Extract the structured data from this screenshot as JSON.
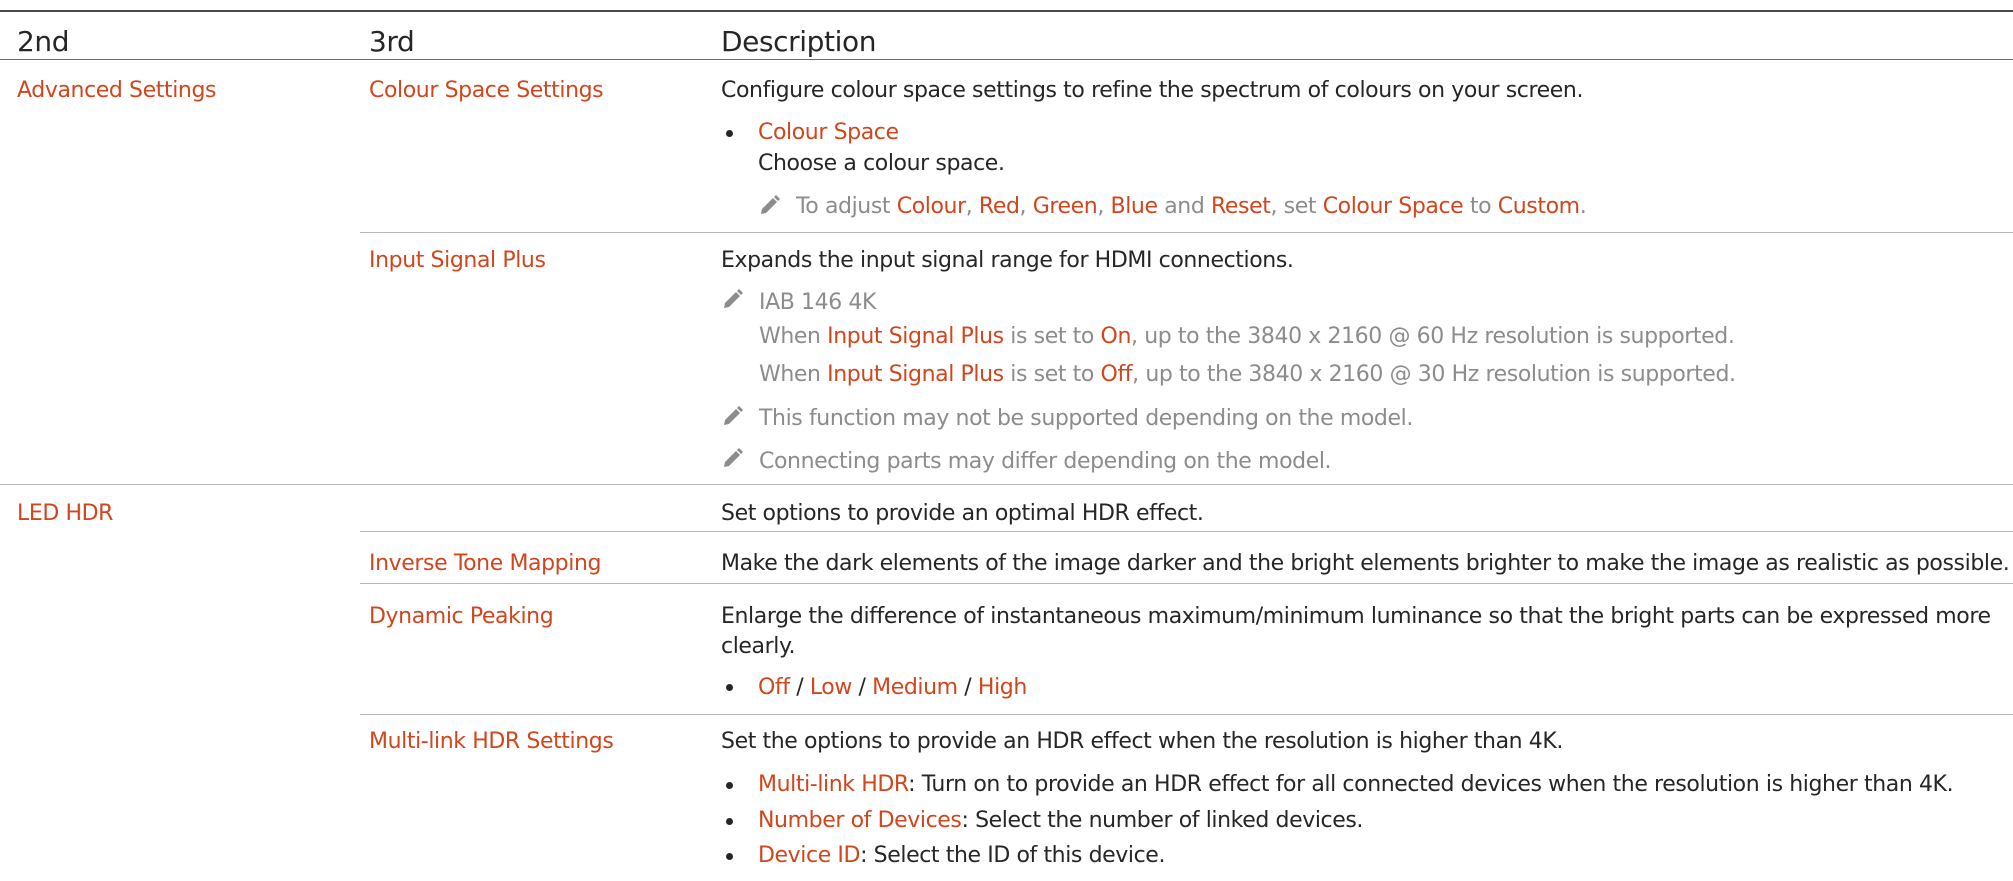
{
  "table": {
    "headers": {
      "col2": "2nd",
      "col3": "3rd",
      "desc": "Description"
    },
    "advanced": {
      "name": "Advanced Settings",
      "colour_space_settings": {
        "name": "Colour Space Settings",
        "desc": "Configure colour space settings to refine the spectrum of colours on your screen.",
        "bullet_title": "Colour Space",
        "bullet_desc": "Choose a colour space.",
        "note": {
          "p1": "To adjust ",
          "colour": "Colour",
          "c1": ", ",
          "red": "Red",
          "c2": ", ",
          "green": "Green",
          "c3": ", ",
          "blue": "Blue",
          "and": " and ",
          "reset": "Reset",
          "set": ", set ",
          "cs": "Colour Space",
          "to": " to ",
          "custom": "Custom",
          "end": "."
        }
      },
      "input_signal_plus": {
        "name": "Input Signal Plus",
        "desc": "Expands the input signal range for HDMI connections.",
        "note1": "IAB 146 4K",
        "line_on": {
          "p1": "When ",
          "isp": "Input Signal Plus",
          "p2": " is set to ",
          "val": "On",
          "p3": ", up to the 3840 x 2160 @ 60 Hz resolution is supported."
        },
        "line_off": {
          "p1": "When ",
          "isp": "Input Signal Plus",
          "p2": " is set to ",
          "val": "Off",
          "p3": ", up to the 3840 x 2160 @ 30 Hz resolution is supported."
        },
        "note2": "This function may not be supported depending on the model.",
        "note3": "Connecting parts may differ depending on the model."
      }
    },
    "led_hdr": {
      "name": "LED HDR",
      "desc": "Set options to provide an optimal HDR effect.",
      "inverse_tone_mapping": {
        "name": "Inverse Tone Mapping",
        "desc": "Make the dark elements of the image darker and the bright elements brighter to make the image as realistic as possible."
      },
      "dynamic_peaking": {
        "name": "Dynamic Peaking",
        "desc_line1": "Enlarge the difference of instantaneous maximum/minimum luminance so that the bright parts can be expressed more",
        "desc_line2": "clearly.",
        "options": {
          "off": "Off",
          "low": "Low",
          "medium": "Medium",
          "high": "High",
          "sep": " / "
        }
      },
      "multi_link": {
        "name": "Multi-link HDR Settings",
        "desc": "Set the options to provide an HDR effect when the resolution is higher than 4K.",
        "b1_title": "Multi-link HDR",
        "b1_text": ": Turn on to provide an HDR effect for all connected devices when the resolution is higher than 4K.",
        "b2_title": "Number of Devices",
        "b2_text": ": Select the number of linked devices.",
        "b3_title": "Device ID",
        "b3_text": ": Select the ID of this device."
      }
    }
  },
  "colors": {
    "accent": "#d0461d",
    "text": "#262626",
    "note": "#8c8c8c",
    "rule": "#b8b8b8"
  },
  "icons": {
    "note": "pencil-icon",
    "bullet": "bullet-dot"
  }
}
